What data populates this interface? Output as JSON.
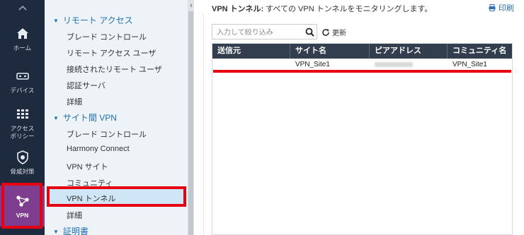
{
  "rail": {
    "items": [
      {
        "label": "ホーム"
      },
      {
        "label": "デバイス"
      },
      {
        "label": "アクセス\nポリシー",
        "line1": "アクセス",
        "line2": "ポリシー"
      },
      {
        "label": "脅威対策"
      },
      {
        "label": "VPN"
      }
    ],
    "active_index": 4
  },
  "sidebar": {
    "sections": [
      {
        "label": "リモート アクセス",
        "items": [
          "ブレード コントロール",
          "リモート アクセス ユーザ",
          "接続されたリモート ユーザ",
          "認証サーバ",
          "詳細"
        ]
      },
      {
        "label": "サイト間 VPN",
        "items": [
          "ブレード コントロール",
          "Harmony Connect",
          "VPN サイト",
          "コミュニティ",
          "VPN トンネル",
          "詳細"
        ]
      },
      {
        "label": "証明書",
        "items": []
      }
    ],
    "selected_item": "VPN トンネル"
  },
  "main": {
    "title_bold": "VPN トンネル:",
    "title_rest": " すべての VPN トンネルをモニタリングします。",
    "print_label": "印刷",
    "search_placeholder": "入力して絞り込み",
    "refresh_label": "更新",
    "table": {
      "columns": [
        "送信元",
        "サイト名",
        "ピアアドレス",
        "コミュニティ名"
      ],
      "rows": [
        {
          "source": "",
          "site_name": "VPN_Site1",
          "peer_address": "(blurred)",
          "community": "VPN_Site1"
        }
      ]
    }
  },
  "colors": {
    "rail_bg": "#1e2a3e",
    "rail_active": "#7e3d8f",
    "sidebar_bg": "#eef3f8",
    "section_blue": "#1f6fb2",
    "table_header": "#323d4d",
    "highlight_red": "#e60012",
    "selected_bg": "#cfe6f7"
  }
}
